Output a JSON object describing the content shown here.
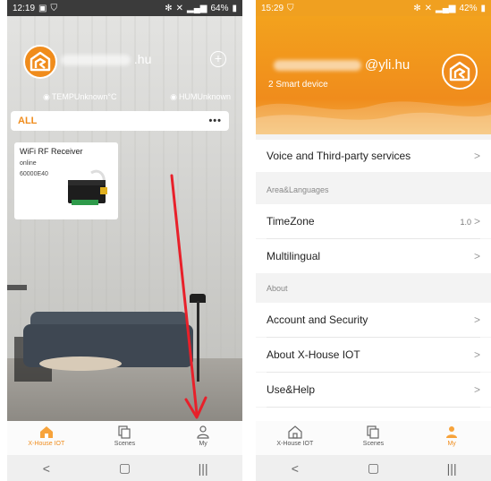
{
  "left_phone": {
    "statusbar": {
      "time": "12:19",
      "battery": "64%"
    },
    "user": {
      "suffix": ".hu"
    },
    "sensors": {
      "temp": "TEMPUnknown°C",
      "hum": "HUMUnknown"
    },
    "group": {
      "name": "ALL",
      "more": "•••"
    },
    "device": {
      "name": "WiFi RF Receiver",
      "status": "online",
      "id": "60000E40"
    },
    "tabs": [
      {
        "label": "X-House IOT",
        "icon": "home-icon",
        "active": true
      },
      {
        "label": "Scenes",
        "icon": "scenes-icon",
        "active": false
      },
      {
        "label": "My",
        "icon": "user-icon",
        "active": false
      }
    ],
    "nav": {
      "back": "<",
      "home": "▢",
      "recent": "|||"
    }
  },
  "right_phone": {
    "statusbar": {
      "time": "15:29",
      "battery": "42%"
    },
    "user": {
      "handle": "@yli.hu"
    },
    "devices": "2 Smart device",
    "menu": {
      "voice": "Voice and Third-party services",
      "section_area": "Area&Languages",
      "timezone": "TimeZone",
      "timezone_value": "1.0",
      "multilingual": "Multilingual",
      "section_about": "About",
      "account": "Account and Security",
      "about": "About X-House IOT",
      "help": "Use&Help"
    },
    "tabs": [
      {
        "label": "X-House IOT",
        "icon": "home-icon",
        "active": false
      },
      {
        "label": "Scenes",
        "icon": "scenes-icon",
        "active": false
      },
      {
        "label": "My",
        "icon": "user-icon",
        "active": true
      }
    ],
    "nav": {
      "back": "<",
      "home": "▢",
      "recent": "|||"
    }
  },
  "colors": {
    "accent": "#f08c1c",
    "annotation_arrow": "#e8202a"
  }
}
